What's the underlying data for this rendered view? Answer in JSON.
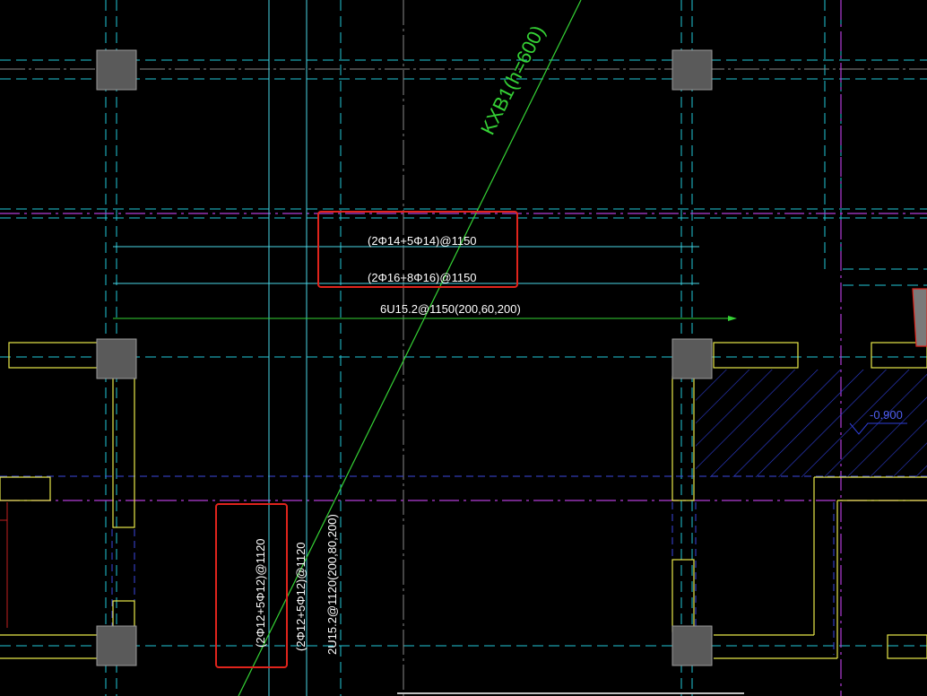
{
  "drawing": {
    "diagonal_label": "KXB1(h=600)",
    "horizontal_rebar_top": "(2Φ14+5Φ14)@1150",
    "horizontal_rebar_bottom": "(2Φ16+8Φ16)@1150",
    "horizontal_stirrup": "6U15.2@1150(200,60,200)",
    "vertical_rebar_a": "(2Φ12+5Φ12)@1120",
    "vertical_rebar_b": "(2Φ12+5Φ12)@1120",
    "vertical_stirrup": "2U15.2@1120(200,80,200)",
    "elevation": "-0.900"
  },
  "colors": {
    "background": "#000000",
    "cyan_axis": "#22c8d8",
    "magenta_axis": "#b23cd8",
    "blue_dashed": "#3b48e0",
    "yellow_beam": "#e8e84a",
    "green_diagonal": "#35d235",
    "column_fill": "#5a5a5a",
    "callout_red": "#e0241c",
    "hatch": "#2e3ed6"
  }
}
